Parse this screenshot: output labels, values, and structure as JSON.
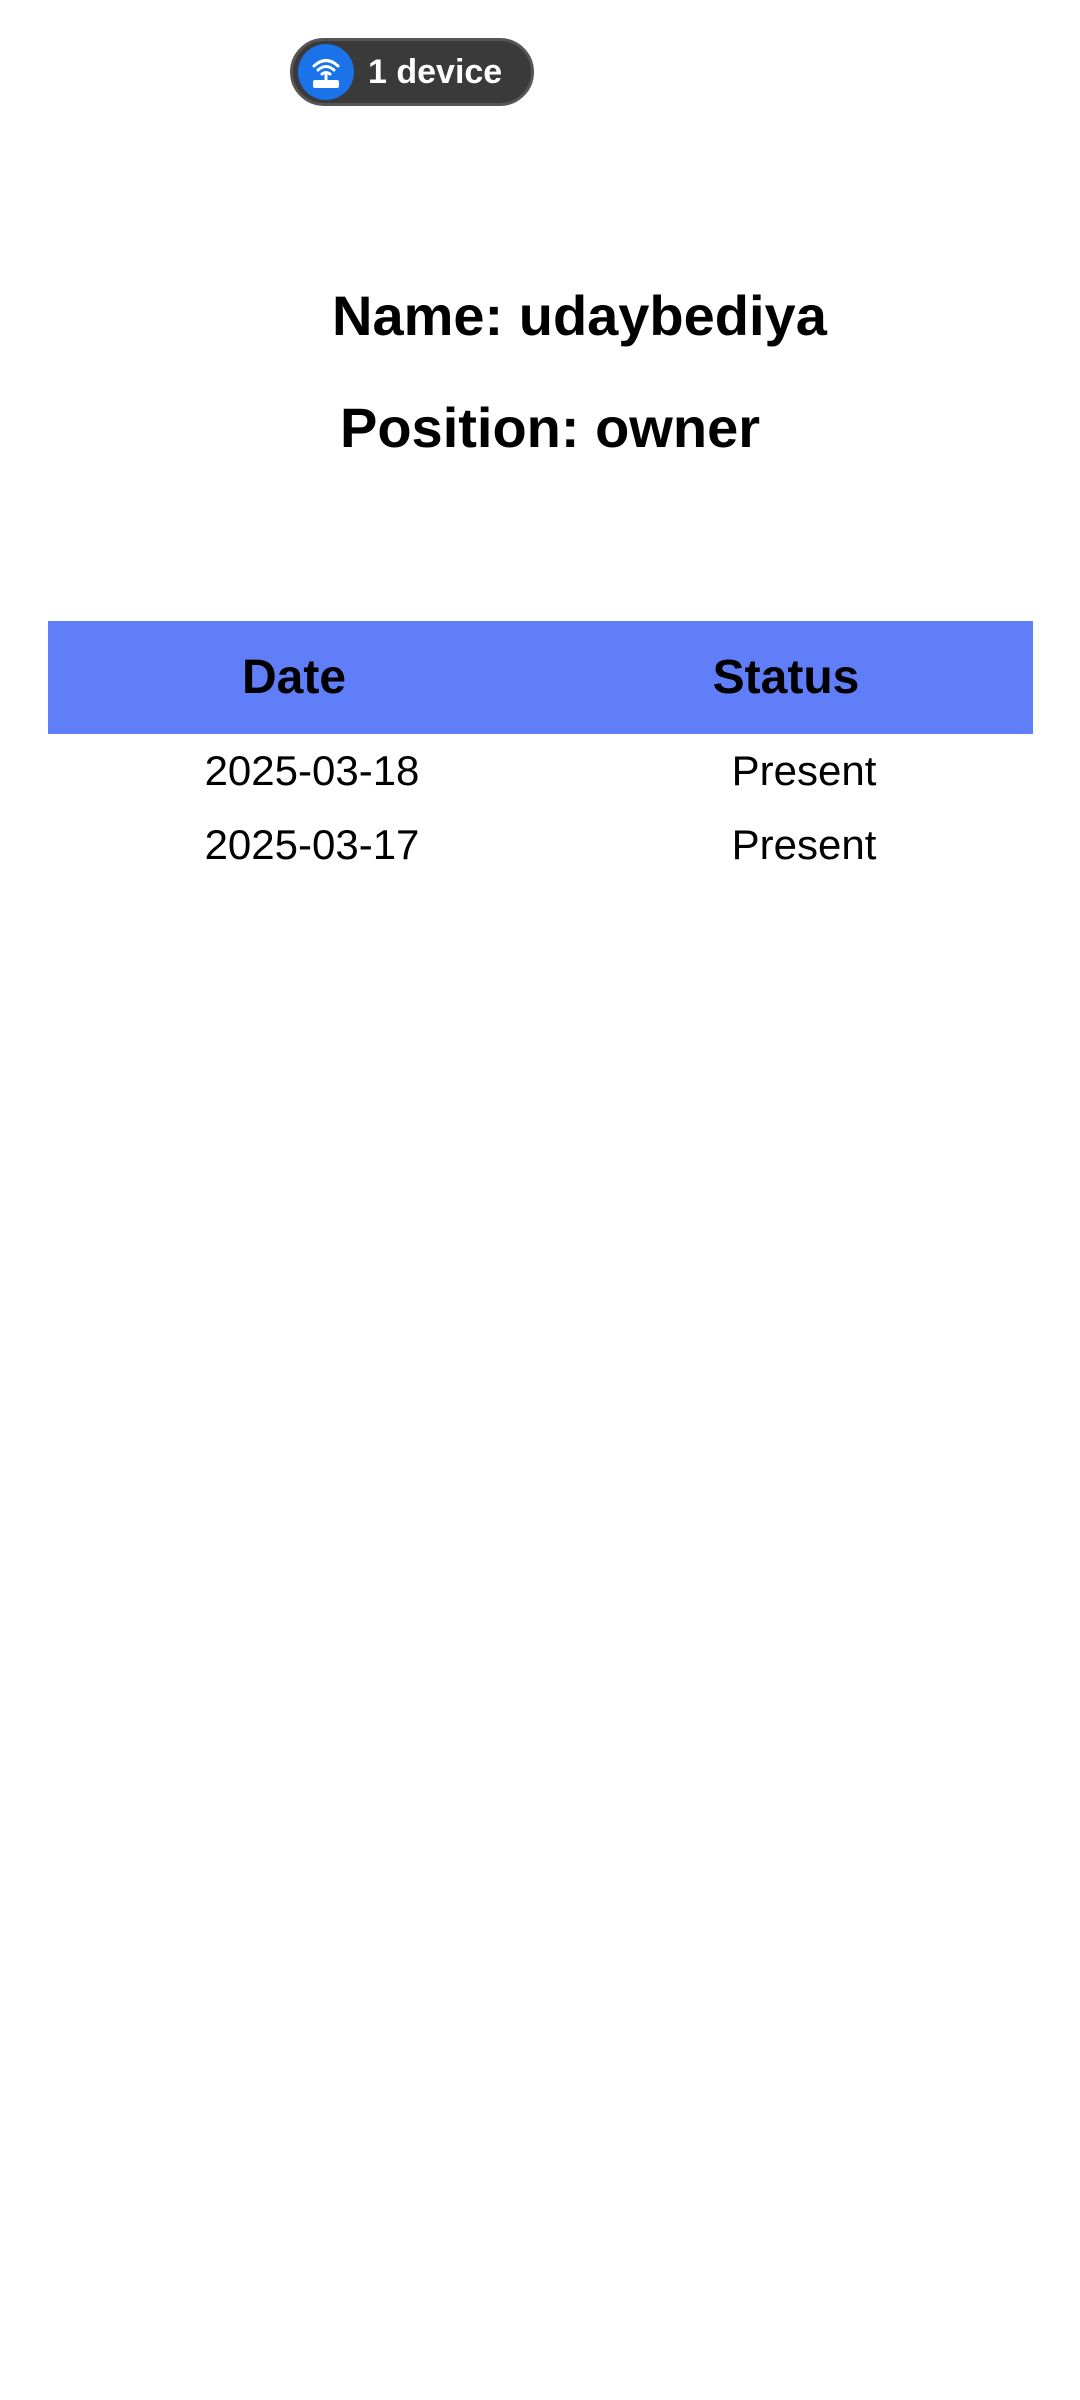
{
  "status_chip": {
    "icon": "wifi-router-icon",
    "label": "1 device",
    "colors": {
      "chip_bg": "#3a3a3a",
      "icon_bg": "#1a73e8"
    }
  },
  "profile": {
    "name_line": "Name: udaybediya",
    "position_line": "Position: owner"
  },
  "attendance": {
    "header_color": "#5f7ef8",
    "columns": [
      "Date",
      "Status"
    ],
    "rows": [
      {
        "date": "2025-03-18",
        "status": "Present"
      },
      {
        "date": "2025-03-17",
        "status": "Present"
      }
    ]
  }
}
